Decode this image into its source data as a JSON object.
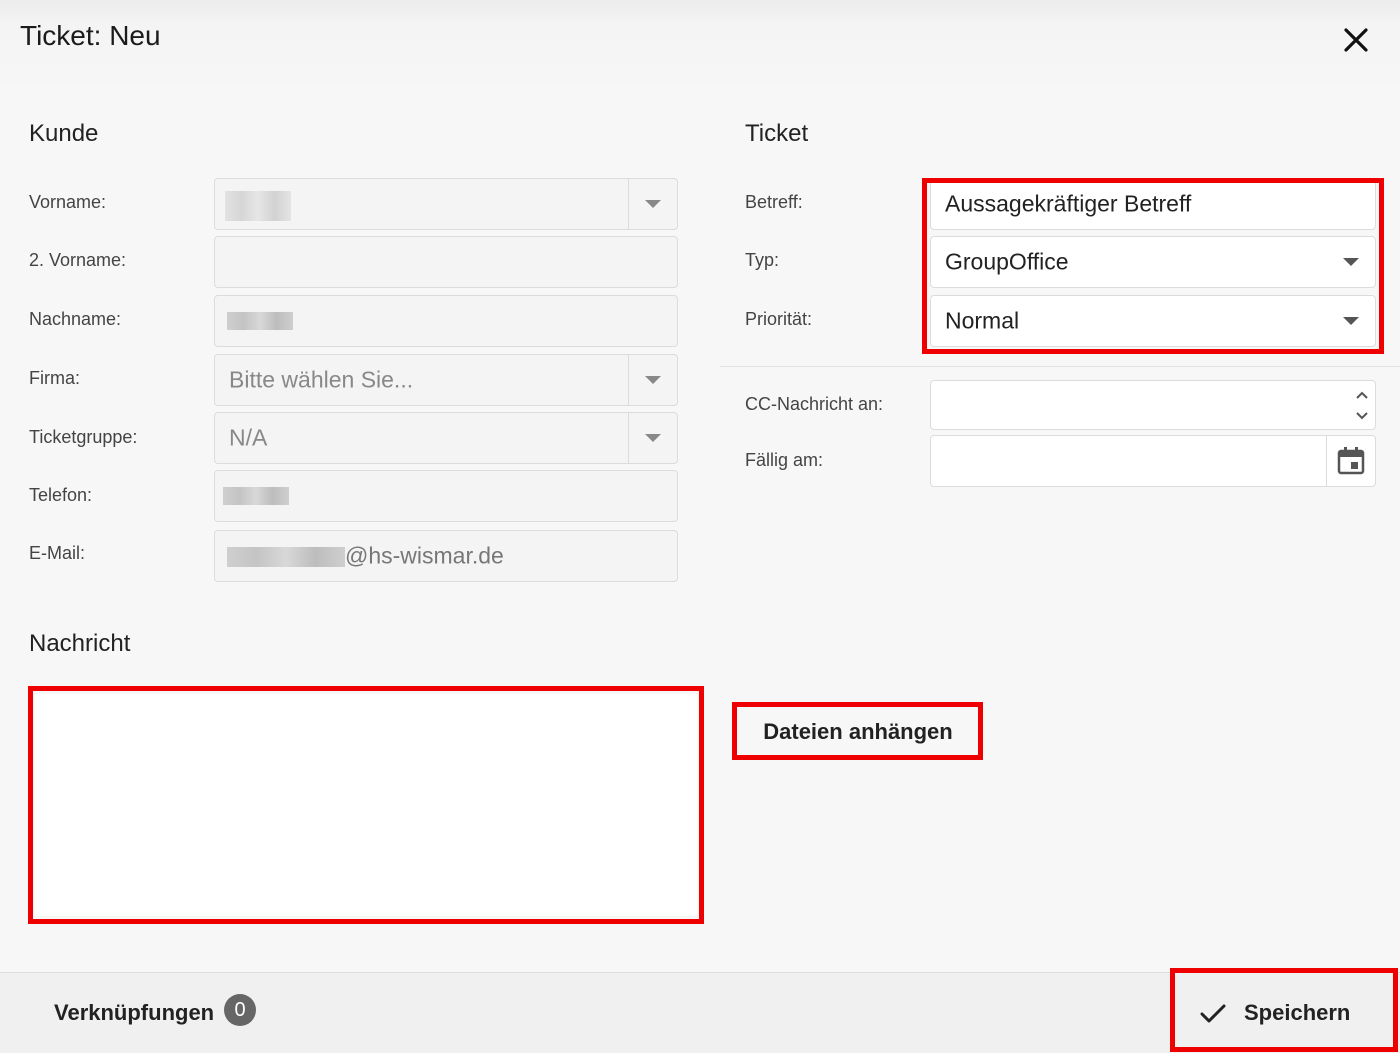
{
  "window": {
    "title": "Ticket: Neu",
    "close_icon": "close-icon"
  },
  "customer": {
    "heading": "Kunde",
    "labels": {
      "firstname": "Vorname:",
      "middlename": "2. Vorname:",
      "lastname": "Nachname:",
      "company": "Firma:",
      "ticketgroup": "Ticketgruppe:",
      "phone": "Telefon:",
      "email": "E-Mail:"
    },
    "company_placeholder": "Bitte wählen Sie...",
    "ticketgroup_value": "N/A",
    "email_suffix": "@hs-wismar.de"
  },
  "ticket": {
    "heading": "Ticket",
    "labels": {
      "subject": "Betreff:",
      "type": "Typ:",
      "priority": "Priorität:",
      "cc": "CC-Nachricht an:",
      "due": "Fällig am:"
    },
    "subject_value": "Aussagekräftiger Betreff",
    "type_value": "GroupOffice",
    "priority_value": "Normal"
  },
  "message": {
    "heading": "Nachricht"
  },
  "attach_button": "Dateien anhängen",
  "footer": {
    "links_label": "Verknüpfungen",
    "links_count": "0",
    "save_label": "Speichern"
  },
  "colors": {
    "highlight": "#ee0000",
    "background": "#f7f7f7"
  }
}
